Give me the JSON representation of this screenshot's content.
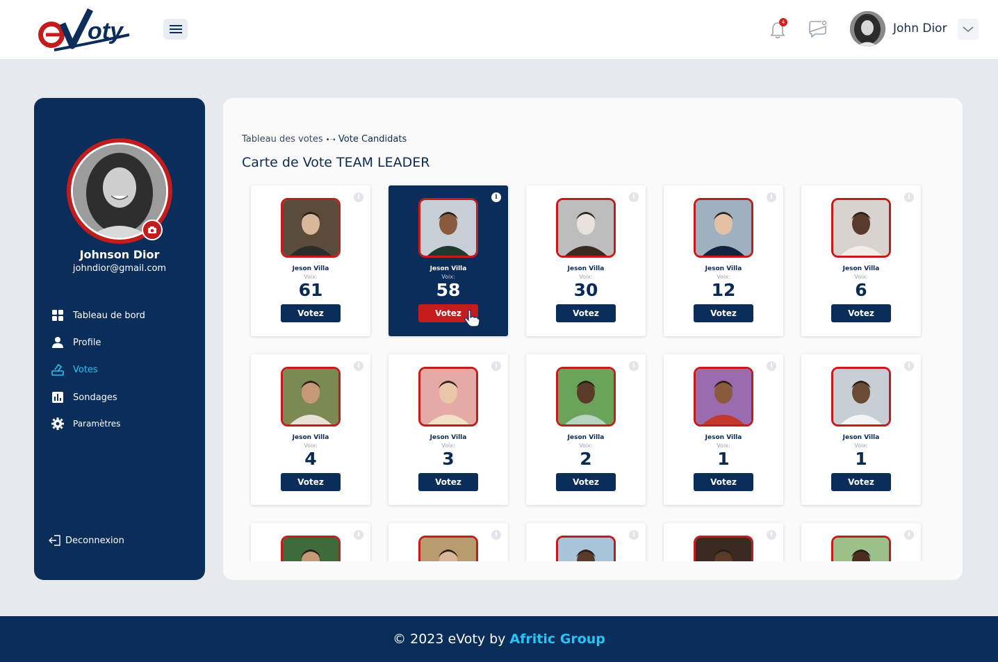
{
  "header": {
    "logo_text": "eVoty",
    "notification_count": "4",
    "user_name": "John Dior",
    "icons": [
      "menu-icon",
      "bell-icon",
      "chat-icon",
      "chevron-down-icon"
    ]
  },
  "sidebar": {
    "profile_name": "Johnson Dior",
    "profile_email": "johndior@gmail.com",
    "nav": [
      {
        "label": "Tableau de bord",
        "icon": "grid-icon",
        "active": false
      },
      {
        "label": "Profile",
        "icon": "user-icon",
        "active": false
      },
      {
        "label": "Votes",
        "icon": "ballot-icon",
        "active": true
      },
      {
        "label": "Sondages",
        "icon": "chart-icon",
        "active": false
      },
      {
        "label": "Paramètres",
        "icon": "gear-icon",
        "active": false
      }
    ],
    "logout_label": "Deconnexion"
  },
  "main": {
    "breadcrumb": {
      "parent": "Tableau des votes",
      "current": "Vote Candidats"
    },
    "title": "Carte de Vote TEAM LEADER",
    "votes_label": "Voix:",
    "vote_button_label": "Votez",
    "candidates": [
      {
        "name": "Jeson Villa",
        "votes": "61",
        "selected": false
      },
      {
        "name": "Jeson Villa",
        "votes": "58",
        "selected": true
      },
      {
        "name": "Jeson Villa",
        "votes": "30",
        "selected": false
      },
      {
        "name": "Jeson Villa",
        "votes": "12",
        "selected": false
      },
      {
        "name": "Jeson Villa",
        "votes": "6",
        "selected": false
      },
      {
        "name": "Jeson Villa",
        "votes": "4",
        "selected": false
      },
      {
        "name": "Jeson Villa",
        "votes": "3",
        "selected": false
      },
      {
        "name": "Jeson Villa",
        "votes": "2",
        "selected": false
      },
      {
        "name": "Jeson Villa",
        "votes": "1",
        "selected": false
      },
      {
        "name": "Jeson Villa",
        "votes": "1",
        "selected": false
      },
      {
        "name": "",
        "votes": "",
        "selected": false
      },
      {
        "name": "",
        "votes": "",
        "selected": false
      },
      {
        "name": "",
        "votes": "",
        "selected": false
      },
      {
        "name": "",
        "votes": "",
        "selected": false
      },
      {
        "name": "",
        "votes": "",
        "selected": false
      }
    ]
  },
  "footer": {
    "text": "© 2023 eVoty by",
    "brand": "Afritic Group"
  },
  "colors": {
    "navy": "#0b2d5a",
    "red": "#c41c1c",
    "cyan": "#27c4f5",
    "background": "#e6e9ee"
  }
}
